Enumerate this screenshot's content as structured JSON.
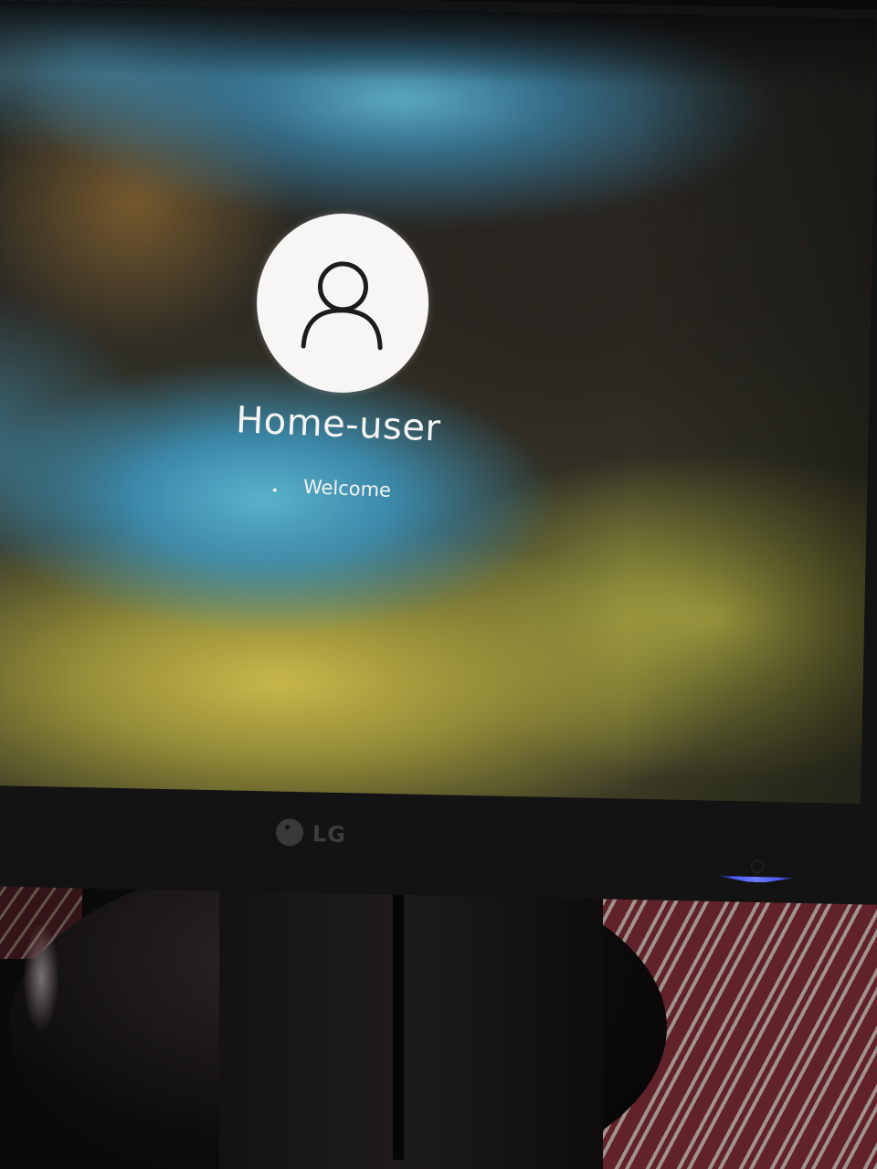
{
  "login_screen": {
    "username": "Home-user",
    "status_text": "Welcome",
    "avatar_icon": "user-silhouette-icon"
  },
  "monitor": {
    "brand": "LG",
    "power_indicator_color": "#4a5cff"
  }
}
